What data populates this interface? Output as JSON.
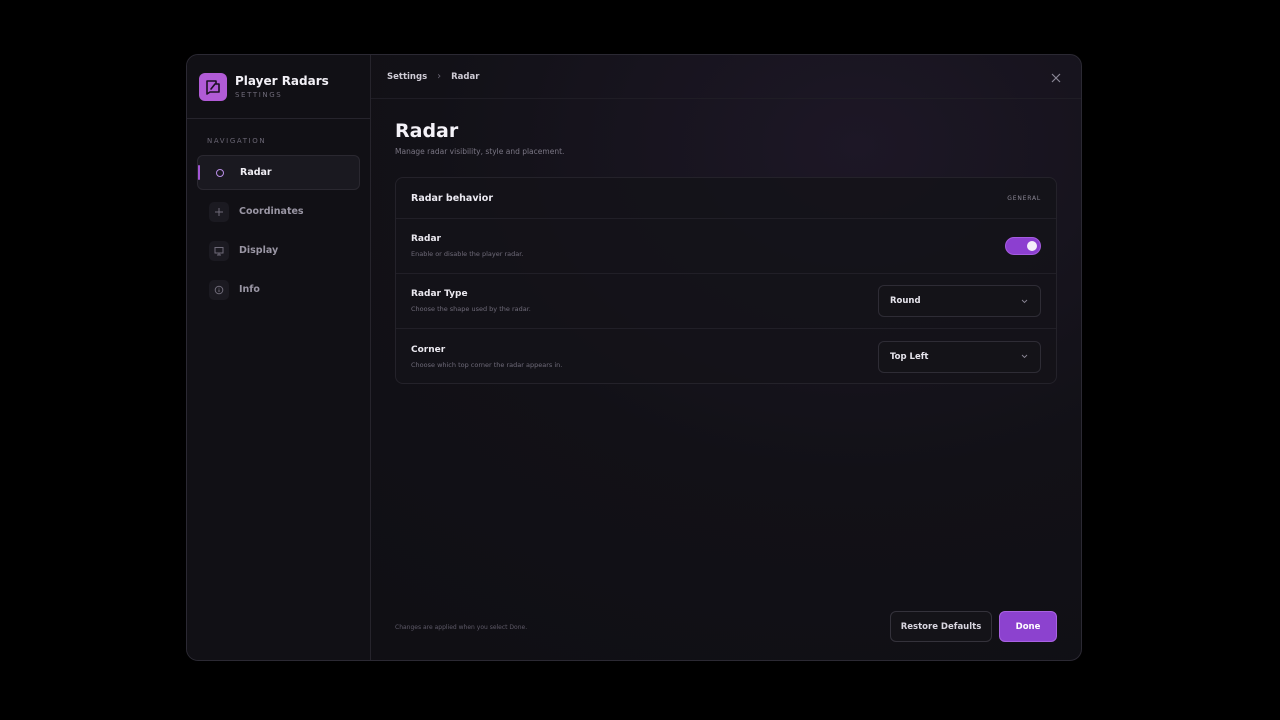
{
  "app": {
    "title": "Player Radars",
    "subtitle": "SETTINGS",
    "accent": "#8c42cf"
  },
  "sidebar": {
    "nav_label": "NAVIGATION",
    "items": [
      {
        "label": "Radar",
        "icon": "radar-icon",
        "active": true
      },
      {
        "label": "Coordinates",
        "icon": "crosshair-icon",
        "active": false
      },
      {
        "label": "Display",
        "icon": "monitor-icon",
        "active": false
      },
      {
        "label": "Info",
        "icon": "info-icon",
        "active": false
      }
    ]
  },
  "breadcrumb": {
    "root": "Settings",
    "current": "Radar"
  },
  "page": {
    "title": "Radar",
    "subtitle": "Manage radar visibility, style and placement."
  },
  "card": {
    "title": "Radar behavior",
    "tag": "GENERAL",
    "rows": [
      {
        "title": "Radar",
        "desc": "Enable or disable the player radar.",
        "control": "toggle",
        "enabled": true
      },
      {
        "title": "Radar Type",
        "desc": "Choose the shape used by the radar.",
        "control": "select",
        "value": "Round"
      },
      {
        "title": "Corner",
        "desc": "Choose which top corner the radar appears in.",
        "control": "select",
        "value": "Top Left"
      }
    ]
  },
  "footer": {
    "note": "Changes are applied when you select Done.",
    "restore_label": "Restore Defaults",
    "done_label": "Done"
  }
}
